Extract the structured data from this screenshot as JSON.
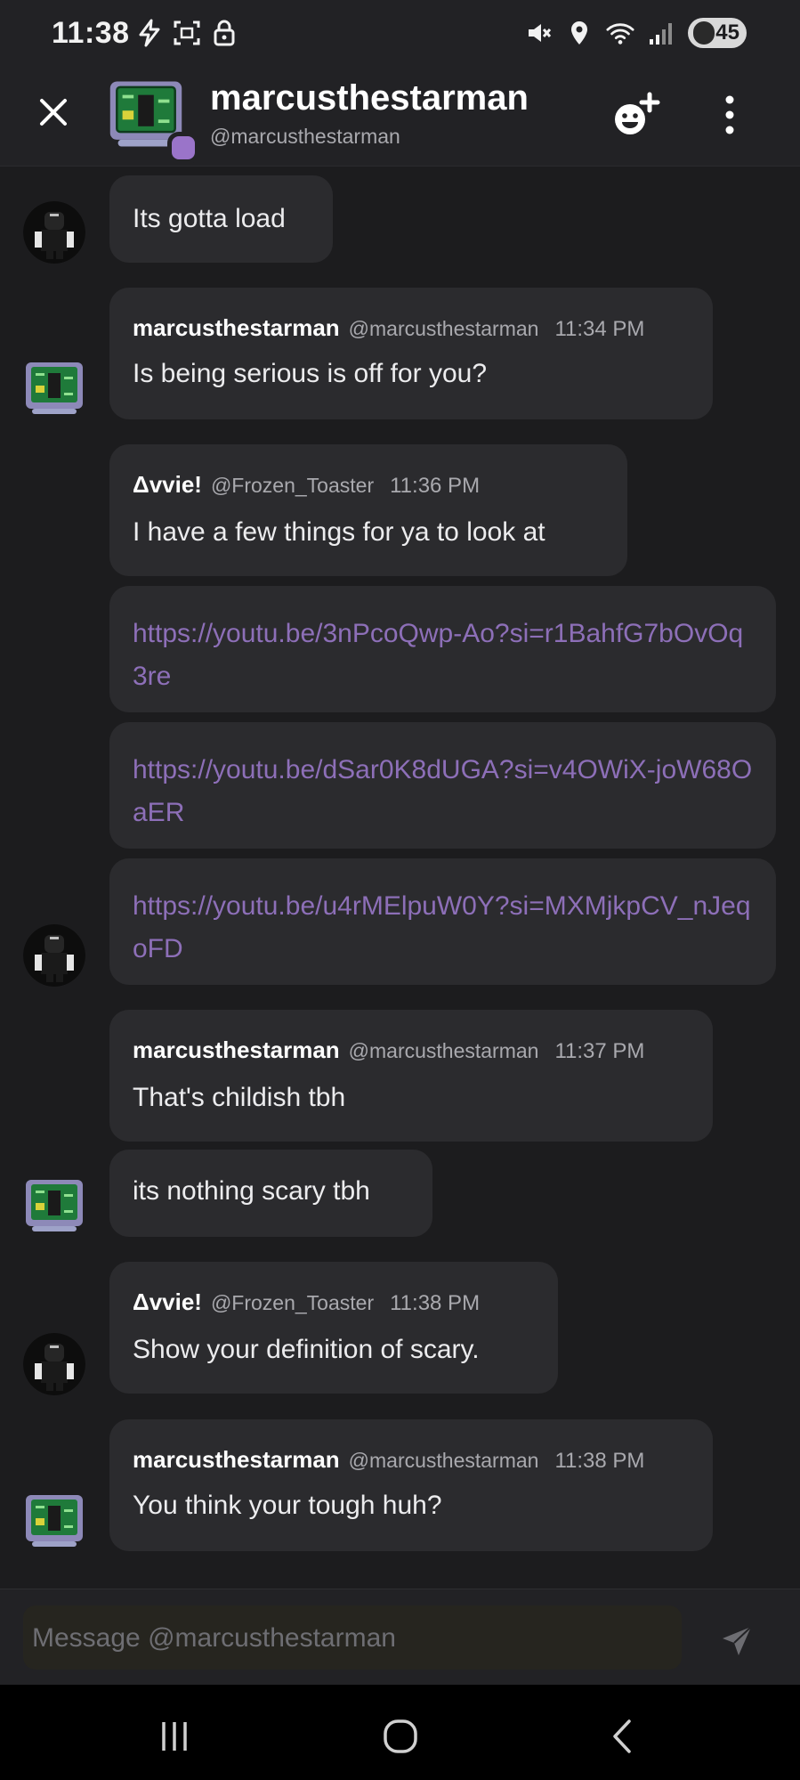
{
  "status_bar": {
    "time": "11:38",
    "battery": "45"
  },
  "header": {
    "name": "marcusthestarman",
    "handle": "@marcusthestarman"
  },
  "messages": [
    {
      "text": "Its gotta load"
    },
    {
      "author": "marcusthestarman",
      "handle": "@marcusthestarman",
      "time": "11:34 PM",
      "text": "Is being serious is off for you?"
    },
    {
      "author": "Δvvie!",
      "handle": "@Frozen_Toaster",
      "time": "11:36 PM",
      "text": "I have a few things for ya to look at"
    },
    {
      "link": "https://youtu.be/3nPcoQwp-Ao?si=r1BahfG7bOvOq3re"
    },
    {
      "link": "https://youtu.be/dSar0K8dUGA?si=v4OWiX-joW68OaER"
    },
    {
      "link": "https://youtu.be/u4rMElpuW0Y?si=MXMjkpCV_nJeqoFD"
    },
    {
      "author": "marcusthestarman",
      "handle": "@marcusthestarman",
      "time": "11:37 PM",
      "text": "That's childish tbh"
    },
    {
      "text": "its nothing scary tbh"
    },
    {
      "author": "Δvvie!",
      "handle": "@Frozen_Toaster",
      "time": "11:38 PM",
      "text": "Show your definition of scary."
    },
    {
      "author": "marcusthestarman",
      "handle": "@marcusthestarman",
      "time": "11:38 PM",
      "text": "You think your tough huh?"
    }
  ],
  "composer": {
    "placeholder": "Message @marcusthestarman"
  },
  "colors": {
    "background": "#1c1c1e",
    "bubble": "#2b2b2e",
    "link": "#8d6fb8",
    "status_dot": "#9a74c9"
  }
}
